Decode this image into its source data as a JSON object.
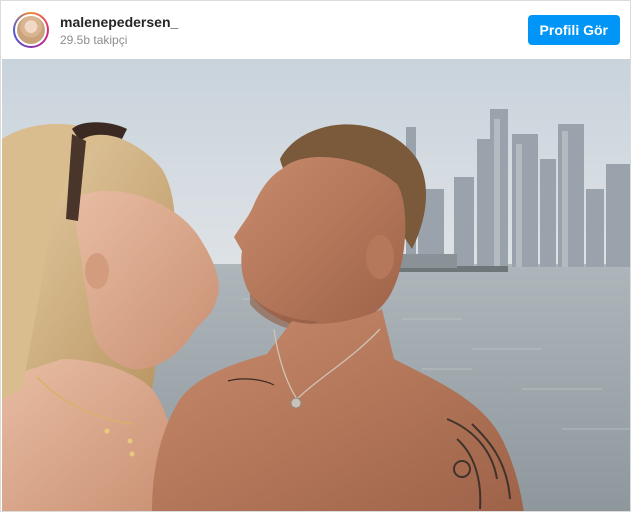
{
  "post": {
    "username": "malenepedersen_",
    "followers": "29.5b takipçi",
    "profile_button_label": "Profili Gör"
  },
  "colors": {
    "accent": "#0095f6",
    "username_text": "#262626",
    "secondary_text": "#8e8e8e"
  },
  "icons": {
    "avatar": "profile-picture"
  }
}
